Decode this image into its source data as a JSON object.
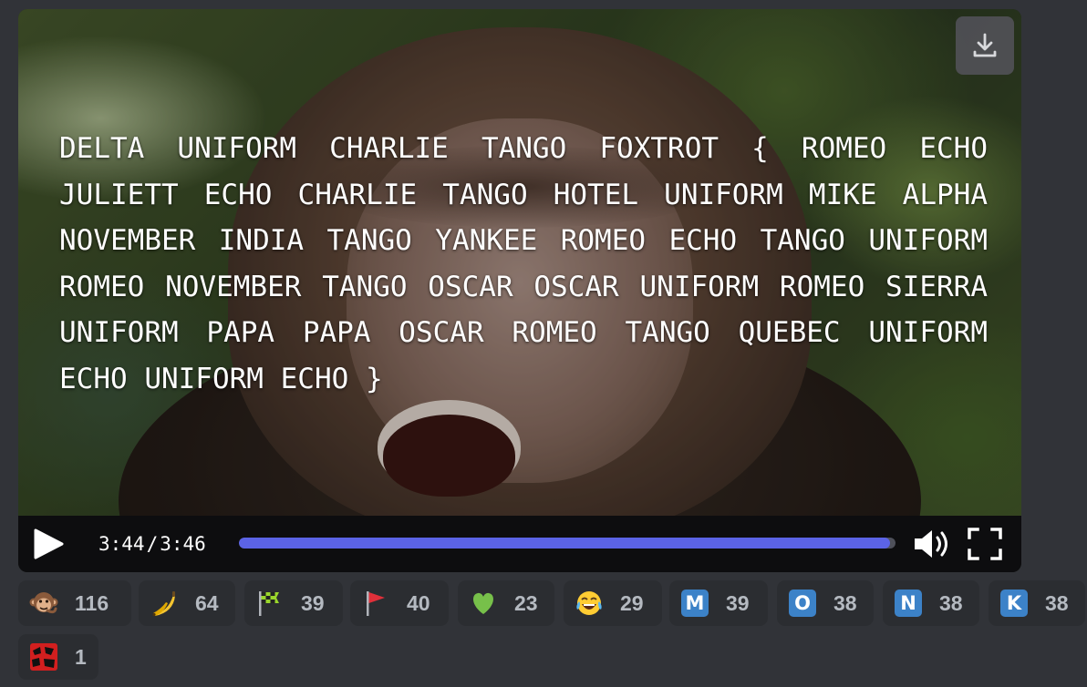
{
  "video": {
    "overlay_text": "DELTA UNIFORM CHARLIE TANGO FOXTROT { ROMEO ECHO JULIETT ECHO CHARLIE TANGO HOTEL UNIFORM MIKE ALPHA NOVEMBER INDIA TANGO YANKEE ROMEO ECHO TANGO UNIFORM ROMEO NOVEMBER TANGO OSCAR OSCAR UNIFORM ROMEO SIERRA UNIFORM PAPA PAPA OSCAR ROMEO TANGO QUEBEC UNIFORM ECHO UNIFORM ECHO }",
    "current_time": "3:44",
    "separator": "/",
    "duration": "3:46",
    "progress_fraction": 0.991,
    "accent_color": "#5b63e6",
    "icons": [
      "download-icon",
      "play-icon",
      "volume-icon",
      "fullscreen-icon"
    ]
  },
  "reactions": [
    {
      "emoji": "monkey",
      "count": "116"
    },
    {
      "emoji": "banana",
      "count": "64"
    },
    {
      "emoji": "chequered-flag",
      "count": "39"
    },
    {
      "emoji": "red-flag",
      "count": "40"
    },
    {
      "emoji": "green-heart",
      "count": "23"
    },
    {
      "emoji": "joy",
      "count": "29"
    },
    {
      "emoji": "letter-tile",
      "letter": "M",
      "count": "39"
    },
    {
      "emoji": "letter-tile",
      "letter": "O",
      "count": "38"
    },
    {
      "emoji": "letter-tile",
      "letter": "N",
      "count": "38"
    },
    {
      "emoji": "letter-tile",
      "letter": "K",
      "count": "38"
    },
    {
      "emoji": "red-custom-emoji",
      "count": "1"
    }
  ]
}
